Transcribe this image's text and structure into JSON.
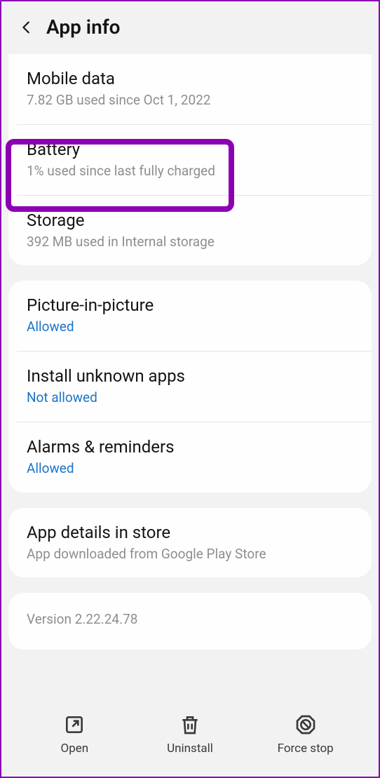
{
  "header": {
    "title": "App info"
  },
  "groups": [
    {
      "items": [
        {
          "title": "Mobile data",
          "subtitle": "7.82 GB used since Oct 1, 2022",
          "highlight": false
        },
        {
          "title": "Battery",
          "subtitle": "1% used since last fully charged",
          "highlight": true
        },
        {
          "title": "Storage",
          "subtitle": "392 MB used in Internal storage",
          "highlight": false
        }
      ]
    },
    {
      "items": [
        {
          "title": "Picture-in-picture",
          "link": "Allowed"
        },
        {
          "title": "Install unknown apps",
          "link": "Not allowed"
        },
        {
          "title": "Alarms & reminders",
          "link": "Allowed"
        }
      ]
    },
    {
      "items": [
        {
          "title": "App details in store",
          "subtitle": "App downloaded from Google Play Store"
        }
      ]
    },
    {
      "version": "Version 2.22.24.78"
    }
  ],
  "bottombar": {
    "open": "Open",
    "uninstall": "Uninstall",
    "forcestop": "Force stop"
  }
}
